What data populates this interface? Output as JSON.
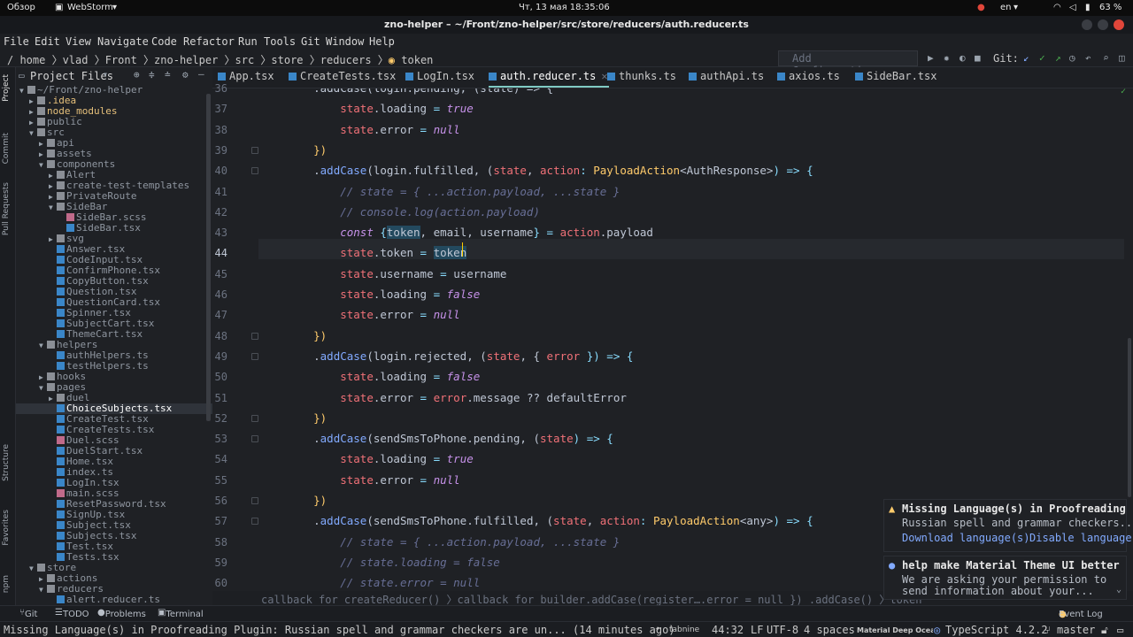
{
  "system_bar": {
    "overview": "Обзор",
    "app": "WebStorm",
    "datetime": "Чт, 13 мая  18:35:06",
    "lang": "en",
    "battery": "63 %"
  },
  "window": {
    "title": "zno-helper – ~/Front/zno-helper/src/store/reducers/auth.reducer.ts"
  },
  "menu": [
    "File",
    "Edit",
    "View",
    "Navigate",
    "Code",
    "Refactor",
    "Run",
    "Tools",
    "Git",
    "Window",
    "Help"
  ],
  "nav": {
    "breadcrumb": "/  home 〉vlad 〉Front 〉zno-helper 〉src 〉store 〉reducers 〉",
    "current": "token",
    "add_config": "Add Configuration...",
    "git_label": "Git:"
  },
  "side_strip": {
    "project": "Project",
    "commit": "Commit",
    "pull_requests": "Pull Requests",
    "structure": "Structure",
    "favorites": "Favorites",
    "npm": "npm"
  },
  "project_panel": {
    "title": "Project Files"
  },
  "tree": [
    {
      "label": "~/Front/zno-helper",
      "depth": 0,
      "kind": "folder",
      "open": true
    },
    {
      "label": ".idea",
      "depth": 1,
      "kind": "folder",
      "open": false
    },
    {
      "label": "node_modules",
      "depth": 1,
      "kind": "folder",
      "open": false
    },
    {
      "label": "public",
      "depth": 1,
      "kind": "folder",
      "open": false
    },
    {
      "label": "src",
      "depth": 1,
      "kind": "folder",
      "open": true
    },
    {
      "label": "api",
      "depth": 2,
      "kind": "folder",
      "open": false
    },
    {
      "label": "assets",
      "depth": 2,
      "kind": "folder",
      "open": false
    },
    {
      "label": "components",
      "depth": 2,
      "kind": "folder",
      "open": true
    },
    {
      "label": "Alert",
      "depth": 3,
      "kind": "folder",
      "open": false
    },
    {
      "label": "create-test-templates",
      "depth": 3,
      "kind": "folder",
      "open": false
    },
    {
      "label": "PrivateRoute",
      "depth": 3,
      "kind": "folder",
      "open": false
    },
    {
      "label": "SideBar",
      "depth": 3,
      "kind": "folder",
      "open": true
    },
    {
      "label": "SideBar.scss",
      "depth": 4,
      "kind": "scss"
    },
    {
      "label": "SideBar.tsx",
      "depth": 4,
      "kind": "tsx"
    },
    {
      "label": "svg",
      "depth": 3,
      "kind": "folder",
      "open": false
    },
    {
      "label": "Answer.tsx",
      "depth": 3,
      "kind": "tsx"
    },
    {
      "label": "CodeInput.tsx",
      "depth": 3,
      "kind": "tsx"
    },
    {
      "label": "ConfirmPhone.tsx",
      "depth": 3,
      "kind": "tsx"
    },
    {
      "label": "CopyButton.tsx",
      "depth": 3,
      "kind": "tsx"
    },
    {
      "label": "Question.tsx",
      "depth": 3,
      "kind": "tsx"
    },
    {
      "label": "QuestionCard.tsx",
      "depth": 3,
      "kind": "tsx"
    },
    {
      "label": "Spinner.tsx",
      "depth": 3,
      "kind": "tsx"
    },
    {
      "label": "SubjectCart.tsx",
      "depth": 3,
      "kind": "tsx"
    },
    {
      "label": "ThemeCart.tsx",
      "depth": 3,
      "kind": "tsx"
    },
    {
      "label": "helpers",
      "depth": 2,
      "kind": "folder",
      "open": true
    },
    {
      "label": "authHelpers.ts",
      "depth": 3,
      "kind": "ts"
    },
    {
      "label": "testHelpers.ts",
      "depth": 3,
      "kind": "ts"
    },
    {
      "label": "hooks",
      "depth": 2,
      "kind": "folder",
      "open": false
    },
    {
      "label": "pages",
      "depth": 2,
      "kind": "folder",
      "open": true
    },
    {
      "label": "duel",
      "depth": 3,
      "kind": "folder",
      "open": false
    },
    {
      "label": "ChoiceSubjects.tsx",
      "depth": 3,
      "kind": "tsx",
      "selected": true
    },
    {
      "label": "CreateTest.tsx",
      "depth": 3,
      "kind": "tsx"
    },
    {
      "label": "CreateTests.tsx",
      "depth": 3,
      "kind": "tsx"
    },
    {
      "label": "Duel.scss",
      "depth": 3,
      "kind": "scss"
    },
    {
      "label": "DuelStart.tsx",
      "depth": 3,
      "kind": "tsx"
    },
    {
      "label": "Home.tsx",
      "depth": 3,
      "kind": "tsx"
    },
    {
      "label": "index.ts",
      "depth": 3,
      "kind": "ts"
    },
    {
      "label": "LogIn.tsx",
      "depth": 3,
      "kind": "tsx"
    },
    {
      "label": "main.scss",
      "depth": 3,
      "kind": "scss"
    },
    {
      "label": "ResetPassword.tsx",
      "depth": 3,
      "kind": "tsx"
    },
    {
      "label": "SignUp.tsx",
      "depth": 3,
      "kind": "tsx"
    },
    {
      "label": "Subject.tsx",
      "depth": 3,
      "kind": "tsx"
    },
    {
      "label": "Subjects.tsx",
      "depth": 3,
      "kind": "tsx"
    },
    {
      "label": "Test.tsx",
      "depth": 3,
      "kind": "tsx"
    },
    {
      "label": "Tests.tsx",
      "depth": 3,
      "kind": "tsx"
    },
    {
      "label": "store",
      "depth": 1,
      "kind": "folder",
      "open": true
    },
    {
      "label": "actions",
      "depth": 2,
      "kind": "folder",
      "open": false
    },
    {
      "label": "reducers",
      "depth": 2,
      "kind": "folder",
      "open": true
    },
    {
      "label": "alert.reducer.ts",
      "depth": 3,
      "kind": "ts"
    }
  ],
  "tabs": [
    {
      "label": "App.tsx",
      "kind": "tsx"
    },
    {
      "label": "CreateTests.tsx",
      "kind": "tsx"
    },
    {
      "label": "LogIn.tsx",
      "kind": "tsx"
    },
    {
      "label": "auth.reducer.ts",
      "kind": "ts",
      "active": true
    },
    {
      "label": "thunks.ts",
      "kind": "ts"
    },
    {
      "label": "authApi.ts",
      "kind": "ts"
    },
    {
      "label": "axios.ts",
      "kind": "ts"
    },
    {
      "label": "SideBar.tsx",
      "kind": "tsx"
    }
  ],
  "code": [
    {
      "n": 36,
      "t": [
        [
          "    .addCase(login.pending, (state) => {",
          "pr"
        ]
      ]
    },
    {
      "n": 37,
      "t": [
        [
          "        ",
          ""
        ],
        [
          "state",
          "vr"
        ],
        [
          ".loading ",
          "pr"
        ],
        [
          "= ",
          "op"
        ],
        [
          "true",
          "bool"
        ]
      ]
    },
    {
      "n": 38,
      "t": [
        [
          "        ",
          ""
        ],
        [
          "state",
          "vr"
        ],
        [
          ".error ",
          "pr"
        ],
        [
          "= ",
          "op"
        ],
        [
          "null",
          "bool"
        ]
      ]
    },
    {
      "n": 39,
      "t": [
        [
          "    ",
          ""
        ],
        [
          "})",
          "ty"
        ]
      ]
    },
    {
      "n": 40,
      "t": [
        [
          "    .",
          "pr"
        ],
        [
          "addCase",
          "fn"
        ],
        [
          "(login.fulfilled, (",
          "pr"
        ],
        [
          "state",
          "vr"
        ],
        [
          ", ",
          "pr"
        ],
        [
          "action",
          "vr"
        ],
        [
          ": ",
          "op"
        ],
        [
          "PayloadAction",
          "ty"
        ],
        [
          "<AuthResponse>",
          "pr"
        ],
        [
          ") => {",
          "op"
        ]
      ]
    },
    {
      "n": 41,
      "t": [
        [
          "        ",
          ""
        ],
        [
          "// state = { ...action.payload, ...state }",
          "cm"
        ]
      ]
    },
    {
      "n": 42,
      "t": [
        [
          "        ",
          ""
        ],
        [
          "// console.log(action.payload)",
          "cm"
        ]
      ]
    },
    {
      "n": 43,
      "t": [
        [
          "        ",
          ""
        ],
        [
          "const ",
          "kw"
        ],
        [
          "{",
          "pu"
        ],
        [
          "token",
          "hl"
        ],
        [
          ", email, username",
          "pr"
        ],
        [
          "}",
          "pu"
        ],
        [
          " = ",
          "op"
        ],
        [
          "action",
          "vr"
        ],
        [
          ".payload",
          "pr"
        ]
      ]
    },
    {
      "n": 44,
      "t": [
        [
          "        ",
          ""
        ],
        [
          "state",
          "vr"
        ],
        [
          ".token ",
          "pr"
        ],
        [
          "= ",
          "op"
        ],
        [
          "token",
          "hl"
        ]
      ]
    },
    {
      "n": 45,
      "t": [
        [
          "        ",
          ""
        ],
        [
          "state",
          "vr"
        ],
        [
          ".username ",
          "pr"
        ],
        [
          "= ",
          "op"
        ],
        [
          "username",
          "pr"
        ]
      ]
    },
    {
      "n": 46,
      "t": [
        [
          "        ",
          ""
        ],
        [
          "state",
          "vr"
        ],
        [
          ".loading ",
          "pr"
        ],
        [
          "= ",
          "op"
        ],
        [
          "false",
          "bool"
        ]
      ]
    },
    {
      "n": 47,
      "t": [
        [
          "        ",
          ""
        ],
        [
          "state",
          "vr"
        ],
        [
          ".error ",
          "pr"
        ],
        [
          "= ",
          "op"
        ],
        [
          "null",
          "bool"
        ]
      ]
    },
    {
      "n": 48,
      "t": [
        [
          "    ",
          ""
        ],
        [
          "})",
          "ty"
        ]
      ]
    },
    {
      "n": 49,
      "t": [
        [
          "    .",
          "pr"
        ],
        [
          "addCase",
          "fn"
        ],
        [
          "(login.rejected, (",
          "pr"
        ],
        [
          "state",
          "vr"
        ],
        [
          ", { ",
          "pr"
        ],
        [
          "error",
          "vr"
        ],
        [
          " }) => {",
          "op"
        ]
      ]
    },
    {
      "n": 50,
      "t": [
        [
          "        ",
          ""
        ],
        [
          "state",
          "vr"
        ],
        [
          ".loading ",
          "pr"
        ],
        [
          "= ",
          "op"
        ],
        [
          "false",
          "bool"
        ]
      ]
    },
    {
      "n": 51,
      "t": [
        [
          "        ",
          ""
        ],
        [
          "state",
          "vr"
        ],
        [
          ".error ",
          "pr"
        ],
        [
          "= ",
          "op"
        ],
        [
          "error",
          "vr"
        ],
        [
          ".message ?? defaultError",
          "pr"
        ]
      ]
    },
    {
      "n": 52,
      "t": [
        [
          "    ",
          ""
        ],
        [
          "})",
          "ty"
        ]
      ]
    },
    {
      "n": 53,
      "t": [
        [
          "    .",
          "pr"
        ],
        [
          "addCase",
          "fn"
        ],
        [
          "(sendSmsToPhone.pending, (",
          "pr"
        ],
        [
          "state",
          "vr"
        ],
        [
          ") => {",
          "op"
        ]
      ]
    },
    {
      "n": 54,
      "t": [
        [
          "        ",
          ""
        ],
        [
          "state",
          "vr"
        ],
        [
          ".loading ",
          "pr"
        ],
        [
          "= ",
          "op"
        ],
        [
          "true",
          "bool"
        ]
      ]
    },
    {
      "n": 55,
      "t": [
        [
          "        ",
          ""
        ],
        [
          "state",
          "vr"
        ],
        [
          ".error ",
          "pr"
        ],
        [
          "= ",
          "op"
        ],
        [
          "null",
          "bool"
        ]
      ]
    },
    {
      "n": 56,
      "t": [
        [
          "    ",
          ""
        ],
        [
          "})",
          "ty"
        ]
      ]
    },
    {
      "n": 57,
      "t": [
        [
          "    .",
          "pr"
        ],
        [
          "addCase",
          "fn"
        ],
        [
          "(sendSmsToPhone.fulfilled, (",
          "pr"
        ],
        [
          "state",
          "vr"
        ],
        [
          ", ",
          "pr"
        ],
        [
          "action",
          "vr"
        ],
        [
          ": ",
          "op"
        ],
        [
          "PayloadAction",
          "ty"
        ],
        [
          "<any>",
          "pr"
        ],
        [
          ") => {",
          "op"
        ]
      ]
    },
    {
      "n": 58,
      "t": [
        [
          "        ",
          ""
        ],
        [
          "// state = { ...action.payload, ...state }",
          "cm"
        ]
      ]
    },
    {
      "n": 59,
      "t": [
        [
          "        ",
          ""
        ],
        [
          "// state.loading = false",
          "cm"
        ]
      ]
    },
    {
      "n": 60,
      "t": [
        [
          "        ",
          ""
        ],
        [
          "// state.error = null",
          "cm"
        ]
      ]
    }
  ],
  "breadcrumb_bottom": "callback for createReducer() 〉callback for builder.addCase(register….error = null }) .addCase() 〉token",
  "tool_windows": {
    "git": "Git",
    "todo": "TODO",
    "problems": "Problems",
    "terminal": "Terminal",
    "event_log": "Event Log"
  },
  "status": {
    "message": "Missing Language(s) in Proofreading Plugin: Russian spell and grammar checkers are un... (14 minutes ago)",
    "tabnine": "tabnine",
    "position": "44:32",
    "line_sep": "LF",
    "encoding": "UTF-8",
    "indent": "4 spaces",
    "theme": "Material Deep Ocean",
    "lang": "TypeScript 4.2.2",
    "branch": "master"
  },
  "notifications": [
    {
      "title": "Missing Language(s) in Proofreading",
      "body": "Russian spell and grammar checkers...",
      "actions": [
        "Download language(s)",
        "Disable language"
      ]
    },
    {
      "title": "help make Material Theme UI better",
      "body": "We are asking your permission to",
      "body2": "send information about your..."
    }
  ]
}
